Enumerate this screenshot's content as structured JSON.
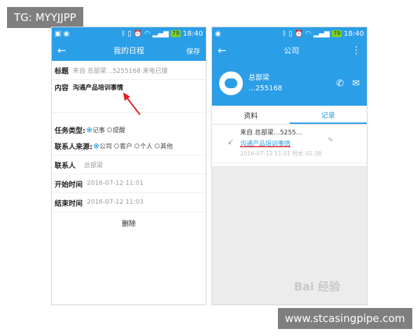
{
  "overlay": {
    "top_left_tag": "TG: MYYJJPP",
    "bottom_right_tag": "www.stcasingpipe.com",
    "watermark": "Bai 经验"
  },
  "status_bar": {
    "time": "18:40",
    "battery": "79"
  },
  "left_screen": {
    "appbar": {
      "title": "我的日程",
      "save": "保存"
    },
    "subject": {
      "label": "标题",
      "value": "来自 总部梁…5255168 来电已接"
    },
    "content": {
      "label": "内容",
      "value": "沟通产品培训事情"
    },
    "task_type": {
      "label": "任务类型:",
      "options": [
        "记事",
        "提醒"
      ]
    },
    "contact_source": {
      "label": "联系人来源:",
      "options": [
        "公司",
        "客户",
        "个人",
        "其他"
      ]
    },
    "contact": {
      "label": "联系人",
      "value": "总部梁"
    },
    "start_time": {
      "label": "开始时间",
      "value": "2016-07-12 11:01"
    },
    "end_time": {
      "label": "结束时间",
      "value": "2016-07-12 11:03"
    },
    "delete": "删除"
  },
  "right_screen": {
    "appbar": {
      "title": "公司"
    },
    "profile": {
      "name": "总部梁",
      "phone": "…255168"
    },
    "tabs": [
      {
        "label": "资料"
      },
      {
        "label": "记录"
      }
    ],
    "record": {
      "line1": "来自 总部梁…5255…",
      "line2": "沟通产品培训事情",
      "line3": "2016-07-12 11:01 时长 01:38"
    }
  }
}
